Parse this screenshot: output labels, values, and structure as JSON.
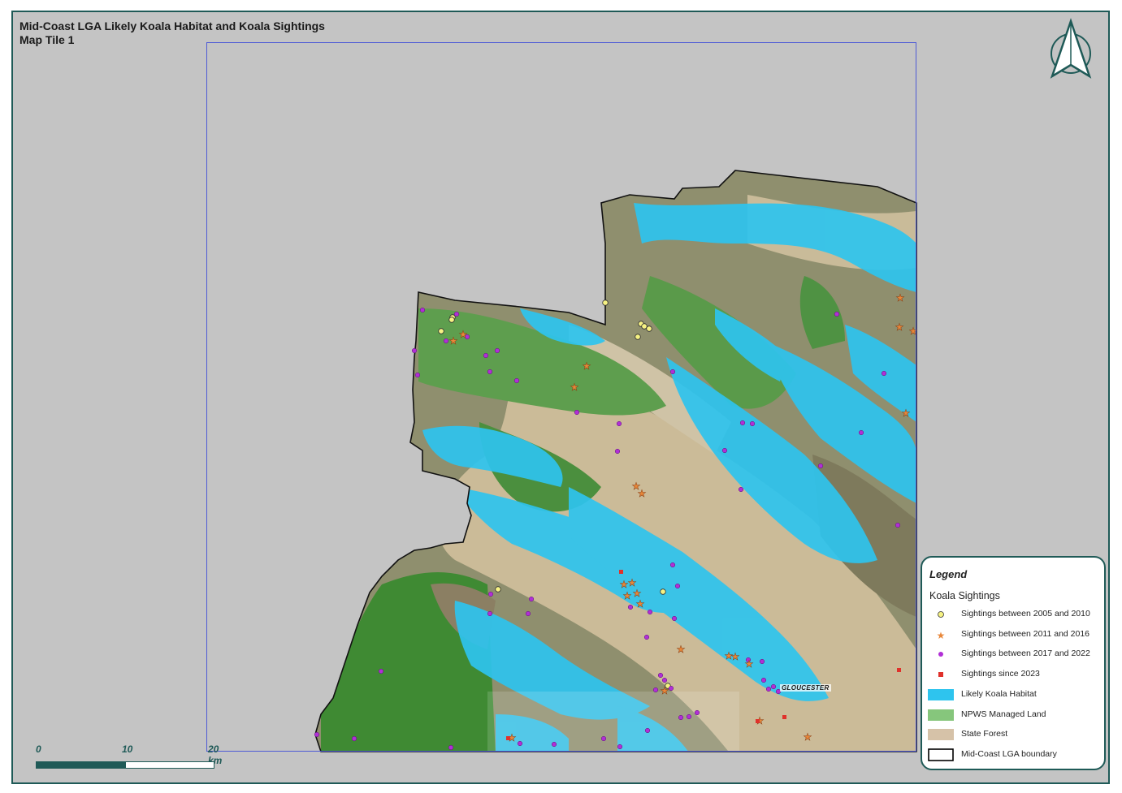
{
  "title": {
    "line1": "Mid-Coast LGA Likely Koala Habitat and Koala Sightings",
    "line2": "Map Tile 1"
  },
  "town_label": "GLOUCESTER",
  "scale_bar": {
    "ticks": [
      "0",
      "10",
      "20 km"
    ]
  },
  "north_arrow": {
    "icon": "north-arrow-icon"
  },
  "legend": {
    "title": "Legend",
    "subtitle": "Koala Sightings",
    "items": [
      {
        "label": "Sightings between 2005 and 2010",
        "symbol": "circle",
        "color": "#f6f283"
      },
      {
        "label": "Sightings between 2011 and 2016",
        "symbol": "star",
        "color": "#e8873a"
      },
      {
        "label": "Sightings between 2017 and 2022",
        "symbol": "circle",
        "color": "#b12fd6"
      },
      {
        "label": "Sightings since 2023",
        "symbol": "square",
        "color": "#e0312b"
      },
      {
        "label": "Likely Koala Habitat",
        "symbol": "patch",
        "color": "#2ec4ee"
      },
      {
        "label": "NPWS Managed Land",
        "symbol": "patch",
        "color": "#86c67c"
      },
      {
        "label": "State Forest",
        "symbol": "patch",
        "color": "#d6c2a8"
      },
      {
        "label": "Mid-Coast LGA boundary",
        "symbol": "outline",
        "color": "#000000"
      }
    ]
  },
  "colors": {
    "frame": "#1f5a57",
    "background": "#c4c4c4",
    "tile_border": "#4f5bd5"
  }
}
